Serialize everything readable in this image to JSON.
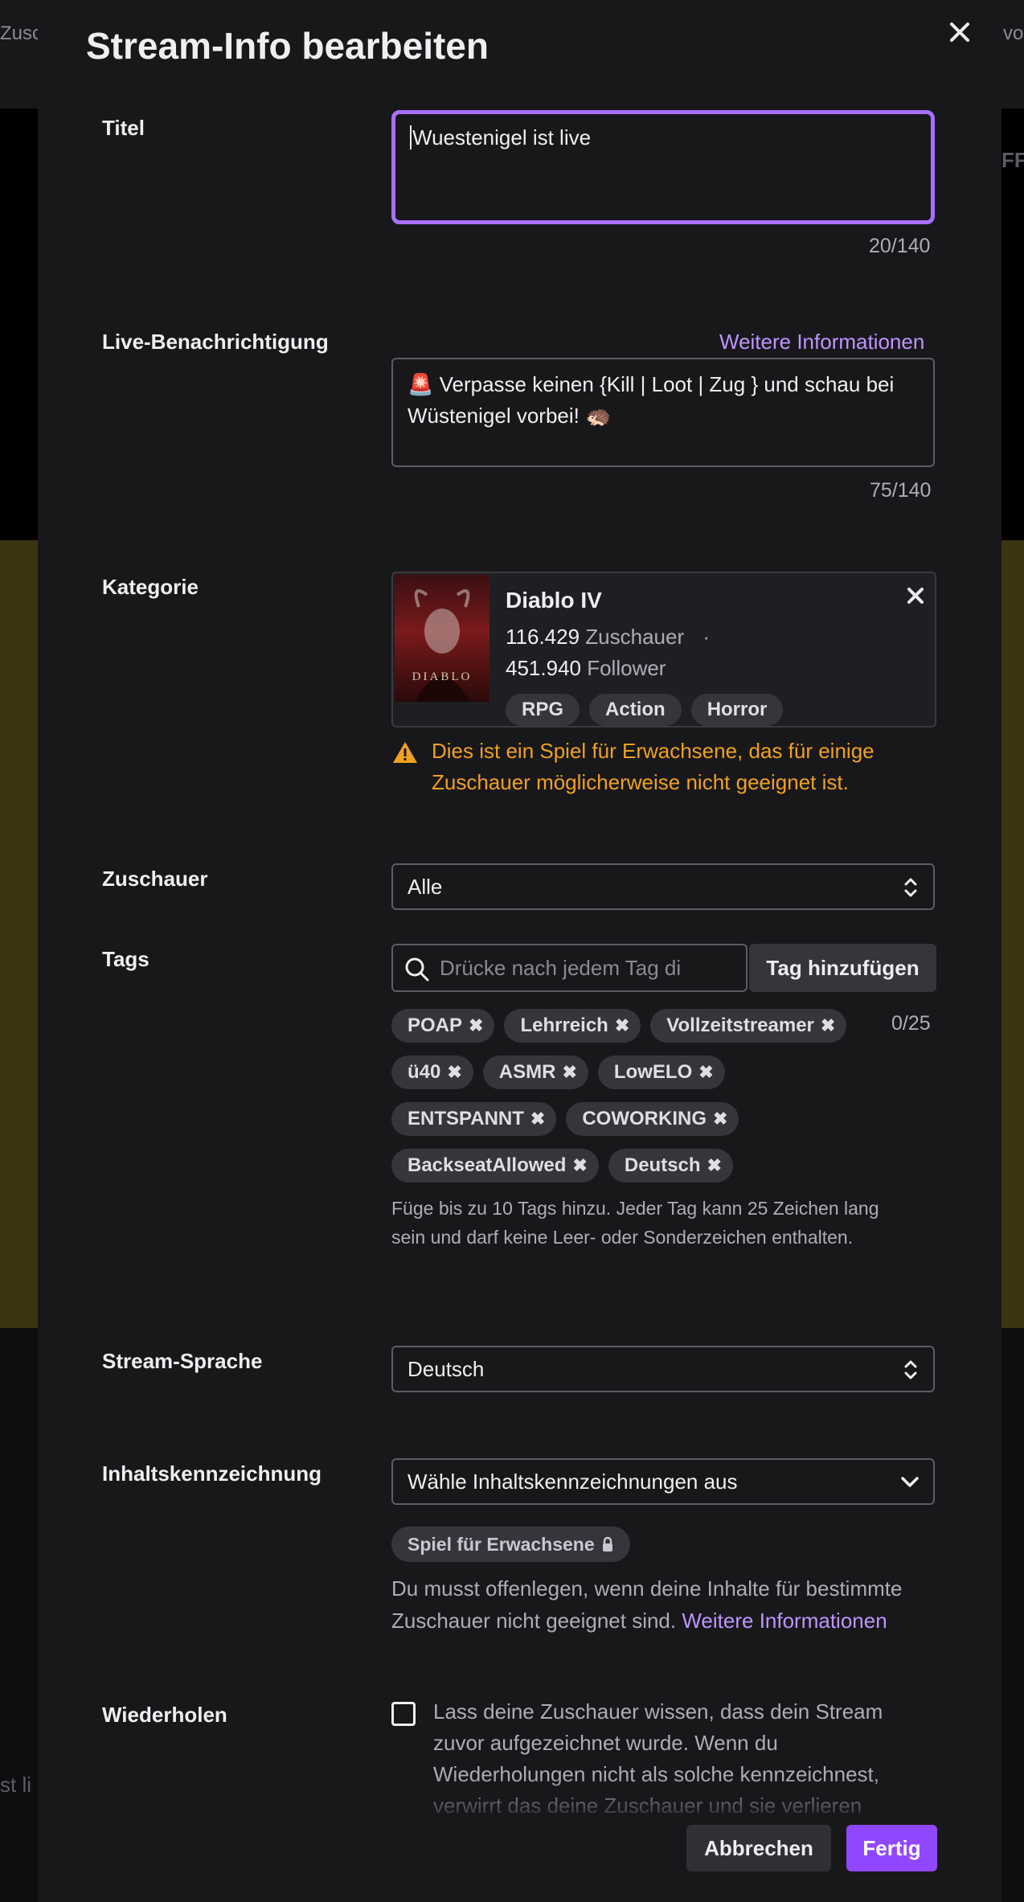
{
  "dialog": {
    "title": "Stream-Info bearbeiten"
  },
  "title_field": {
    "label": "Titel",
    "value": "Wuestenigel ist live",
    "counter": "20/140"
  },
  "notification": {
    "label": "Live-Benachrichtigung",
    "more_info_link": "Weitere Informationen",
    "emoji_start": "🚨",
    "value": " Verpasse keinen {Kill | Loot | Zug } und schau bei Wüstenigel vorbei! ",
    "emoji_end": "🦔",
    "counter": "75/140"
  },
  "category": {
    "label": "Kategorie",
    "cover_text": "DIABLO",
    "name": "Diablo IV",
    "viewers_value": "116.429",
    "viewers_label": "Zuschauer",
    "separator": "·",
    "followers_value": "451.940",
    "followers_label": "Follower",
    "tags": [
      "RPG",
      "Action",
      "Horror"
    ],
    "warning": "Dies ist ein Spiel für Erwachsene, das für einige Zuschauer möglicherweise nicht geeignet ist."
  },
  "audience": {
    "label": "Zuschauer",
    "value": "Alle"
  },
  "tags": {
    "label": "Tags",
    "search_placeholder": "Drücke nach jedem Tag di",
    "add_button": "Tag hinzufügen",
    "counter": "0/25",
    "items": [
      "POAP",
      "Lehrreich",
      "Vollzeitstreamer",
      "ü40",
      "ASMR",
      "LowELO",
      "ENTSPANNT",
      "COWORKING",
      "BackseatAllowed",
      "Deutsch"
    ],
    "help": "Füge bis zu 10 Tags hinzu. Jeder Tag kann 25 Zeichen lang sein und darf keine Leer- oder Sonderzeichen enthalten."
  },
  "language": {
    "label": "Stream-Sprache",
    "value": "Deutsch"
  },
  "content_classification": {
    "label": "Inhaltskennzeichnung",
    "placeholder": "Wähle Inhaltskennzeichnungen aus",
    "locked_chip": "Spiel für Erwachsene",
    "help": "Du musst offenlegen, wenn deine Inhalte für bestimmte Zuschauer nicht geeignet sind.",
    "more_info_link": "Weitere Informationen"
  },
  "rerun": {
    "label": "Wiederholen",
    "text": "Lass deine Zuschauer wissen, dass dein Stream zuvor aufgezeichnet wurde. Wenn du Wiederholungen nicht als solche kennzeichnest, verwirrt das deine Zuschauer und sie verlieren"
  },
  "footer": {
    "cancel_button": "Abbrechen",
    "done_button": "Fertig"
  },
  "background_fragments": {
    "top_left": "Zusc",
    "top_right": "vo",
    "right_offline": "FF",
    "bottom_left": "st li"
  },
  "colors": {
    "accent": "#9147ff",
    "focus_border": "#a970ff",
    "link": "#bf94ff",
    "warning": "#f0a020",
    "background_yellow": "#3a3410"
  }
}
